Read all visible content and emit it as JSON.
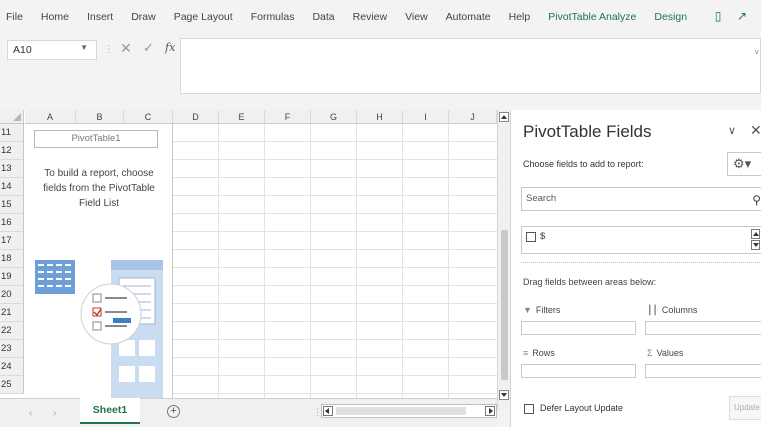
{
  "ribbon": {
    "tabs": [
      "File",
      "Home",
      "Insert",
      "Draw",
      "Page Layout",
      "Formulas",
      "Data",
      "Review",
      "View",
      "Automate",
      "Help"
    ],
    "context_tabs": [
      "PivotTable Analyze",
      "Design"
    ],
    "accent_color": "#217346"
  },
  "formula_bar": {
    "name_box": "A10",
    "fx_label": "fx",
    "value": ""
  },
  "grid": {
    "columns": [
      "A",
      "B",
      "C",
      "D",
      "E",
      "F",
      "G",
      "H",
      "I",
      "J"
    ],
    "rows": [
      "11",
      "12",
      "13",
      "14",
      "15",
      "16",
      "17",
      "18",
      "19",
      "20",
      "21",
      "22",
      "23",
      "24",
      "25"
    ]
  },
  "pivot_placeholder": {
    "title": "PivotTable1",
    "message_lines": [
      "To build a report, choose",
      "fields from the PivotTable",
      "Field List"
    ]
  },
  "sheets": {
    "active": "Sheet1"
  },
  "pane": {
    "title": "PivotTable Fields",
    "choose_label": "Choose fields to add to report:",
    "search_placeholder": "Search",
    "fields": [
      {
        "label": "$",
        "checked": false
      }
    ],
    "drag_label": "Drag fields between areas below:",
    "areas": {
      "filters": "Filters",
      "columns": "Columns",
      "rows": "Rows",
      "values": "Values"
    },
    "defer_label": "Defer Layout Update",
    "update_label": "Update"
  }
}
